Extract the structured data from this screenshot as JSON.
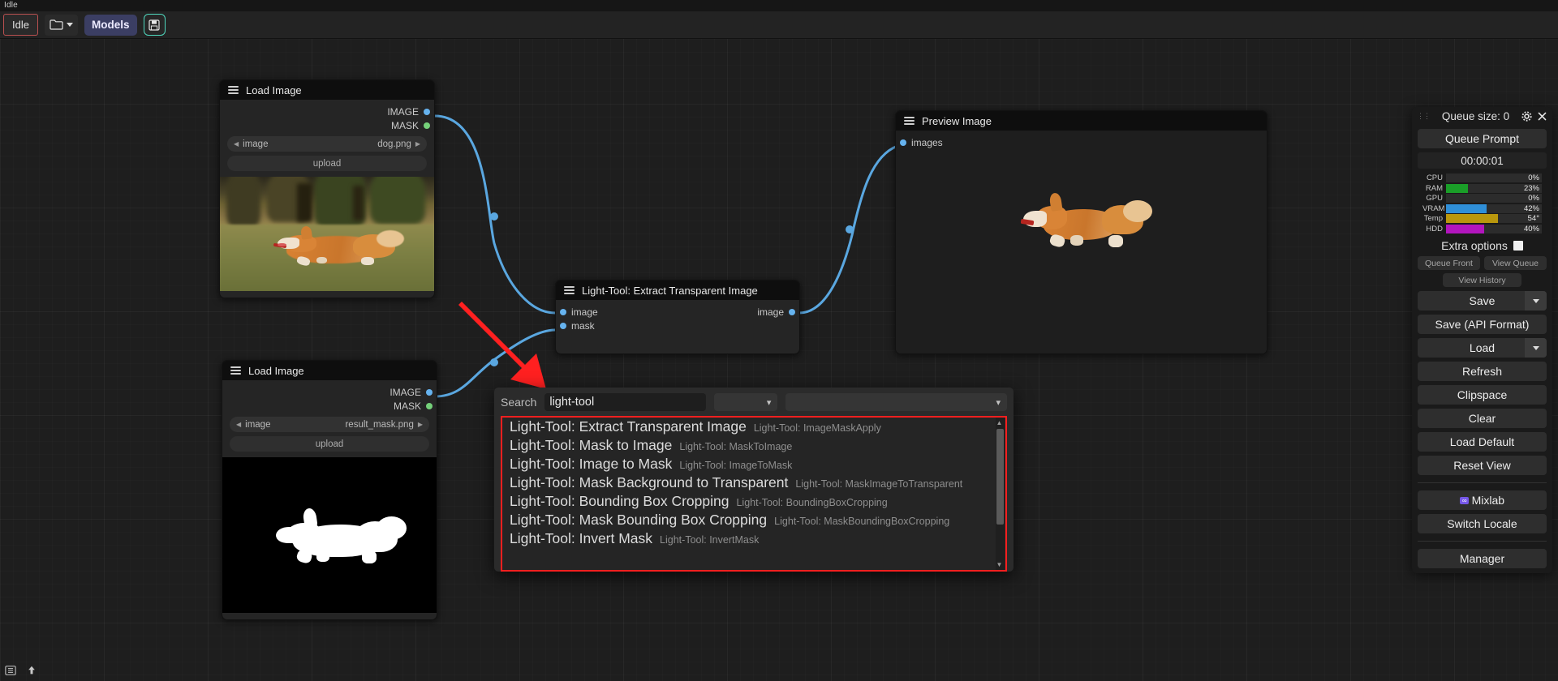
{
  "app": {
    "status_text": "Idle",
    "colors": {
      "accent_blue": "#66b3ef",
      "accent_green": "#75d17a",
      "highlight_red": "#ff1f1f",
      "models_bg": "#3b3e63",
      "save_border": "#4fd7bd",
      "ram_bar": "#1a9e28",
      "vram_bar": "#2f8fd8",
      "temp_bar": "#b9970d",
      "hdd_bar": "#b215bd"
    }
  },
  "menubar": {
    "idle_label": "Idle",
    "folder_icon": "folder-icon",
    "folder_caret_icon": "chevron-down-icon",
    "models_label": "Models",
    "save_icon": "floppy-disk-icon"
  },
  "nodes": {
    "load_image_1": {
      "title": "Load Image",
      "menu_icon": "hamburger-icon",
      "outputs": [
        {
          "label": "IMAGE",
          "type": "image"
        },
        {
          "label": "MASK",
          "type": "mask"
        }
      ],
      "widget_label": "image",
      "widget_value": "dog.png",
      "upload_label": "upload",
      "thumbnail_alt": "corgi-running-in-grass"
    },
    "load_image_2": {
      "title": "Load Image",
      "menu_icon": "hamburger-icon",
      "outputs": [
        {
          "label": "IMAGE",
          "type": "image"
        },
        {
          "label": "MASK",
          "type": "mask"
        }
      ],
      "widget_label": "image",
      "widget_value": "result_mask.png",
      "upload_label": "upload",
      "thumbnail_alt": "white-corgi-silhouette-mask-on-black"
    },
    "light_tool": {
      "title": "Light-Tool: Extract Transparent Image",
      "menu_icon": "hamburger-icon",
      "inputs": [
        {
          "label": "image",
          "type": "image"
        },
        {
          "label": "mask",
          "type": "image"
        }
      ],
      "outputs": [
        {
          "label": "image",
          "type": "image"
        }
      ]
    },
    "preview_image": {
      "title": "Preview Image",
      "menu_icon": "hamburger-icon",
      "inputs": [
        {
          "label": "images",
          "type": "image"
        }
      ],
      "thumbnail_alt": "corgi-cutout-transparent-background"
    }
  },
  "search_dialog": {
    "label": "Search",
    "query": "light-tool",
    "placeholder": "",
    "filter_a": "",
    "filter_b": "",
    "dropdown_icon": "chevron-down-icon",
    "results": [
      {
        "name": "Light-Tool: Extract Transparent Image",
        "id": "Light-Tool: ImageMaskApply"
      },
      {
        "name": "Light-Tool: Mask to Image",
        "id": "Light-Tool: MaskToImage"
      },
      {
        "name": "Light-Tool: Image to Mask",
        "id": "Light-Tool: ImageToMask"
      },
      {
        "name": "Light-Tool: Mask Background to Transparent",
        "id": "Light-Tool: MaskImageToTransparent"
      },
      {
        "name": "Light-Tool: Bounding Box Cropping",
        "id": "Light-Tool: BoundingBoxCropping"
      },
      {
        "name": "Light-Tool: Mask Bounding Box Cropping",
        "id": "Light-Tool: MaskBoundingBoxCropping"
      },
      {
        "name": "Light-Tool: Invert Mask",
        "id": "Light-Tool: InvertMask"
      }
    ]
  },
  "panel": {
    "title": "Queue size: 0",
    "gear_icon": "gear-icon",
    "close_icon": "close-icon",
    "queue_prompt_label": "Queue Prompt",
    "timer": "00:00:01",
    "resources": [
      {
        "label": "CPU",
        "value": "0%",
        "pct": 0,
        "color": "#2c2c2c"
      },
      {
        "label": "RAM",
        "value": "23%",
        "pct": 23,
        "color": "#1a9e28"
      },
      {
        "label": "GPU",
        "value": "0%",
        "pct": 0,
        "color": "#2c2c2c"
      },
      {
        "label": "VRAM",
        "value": "42%",
        "pct": 42,
        "color": "#2f8fd8"
      },
      {
        "label": "Temp",
        "value": "54°",
        "pct": 54,
        "color": "#b9970d"
      },
      {
        "label": "HDD",
        "value": "40%",
        "pct": 40,
        "color": "#b215bd"
      }
    ],
    "extra_options_label": "Extra options",
    "queue_front_label": "Queue Front",
    "view_queue_label": "View Queue",
    "view_history_label": "View History",
    "save_label": "Save",
    "save_api_label": "Save (API Format)",
    "load_label": "Load",
    "refresh_label": "Refresh",
    "clipspace_label": "Clipspace",
    "clear_label": "Clear",
    "load_default_label": "Load Default",
    "reset_view_label": "Reset View",
    "mixlab_label": "Mixlab",
    "mixlab_badge": "∞",
    "switch_locale_label": "Switch Locale",
    "manager_label": "Manager"
  },
  "bottom_bar": {
    "list_icon": "list-view-icon",
    "upload_icon": "upload-arrow-icon"
  },
  "annotation": {
    "arrow_icon": "red-arrow-pointing-to-search",
    "arrow_color": "#ff2020"
  }
}
